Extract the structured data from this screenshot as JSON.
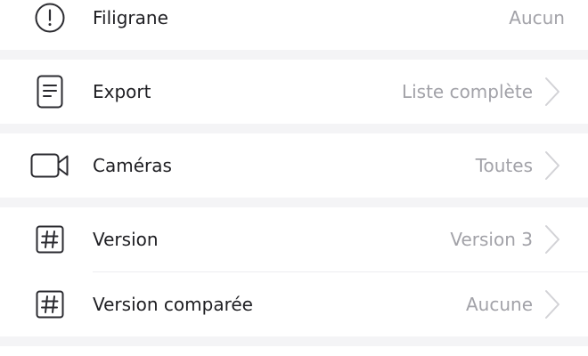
{
  "rows": {
    "watermark": {
      "label": "Filigrane",
      "value": "Aucun",
      "icon": "alert-circle-icon"
    },
    "export": {
      "label": "Export",
      "value": "Liste complète",
      "icon": "document-icon"
    },
    "cameras": {
      "label": "Caméras",
      "value": "Toutes",
      "icon": "video-camera-icon"
    },
    "version": {
      "label": "Version",
      "value": "Version 3",
      "icon": "hash-icon"
    },
    "compared_version": {
      "label": "Version comparée",
      "value": "Aucune",
      "icon": "hash-icon"
    }
  },
  "colors": {
    "background": "#f4f4f6",
    "card": "#ffffff",
    "label": "#1e1e22",
    "value": "#a2a2a8",
    "icon": "#2b2b30",
    "chevron": "#d2d2d6"
  }
}
